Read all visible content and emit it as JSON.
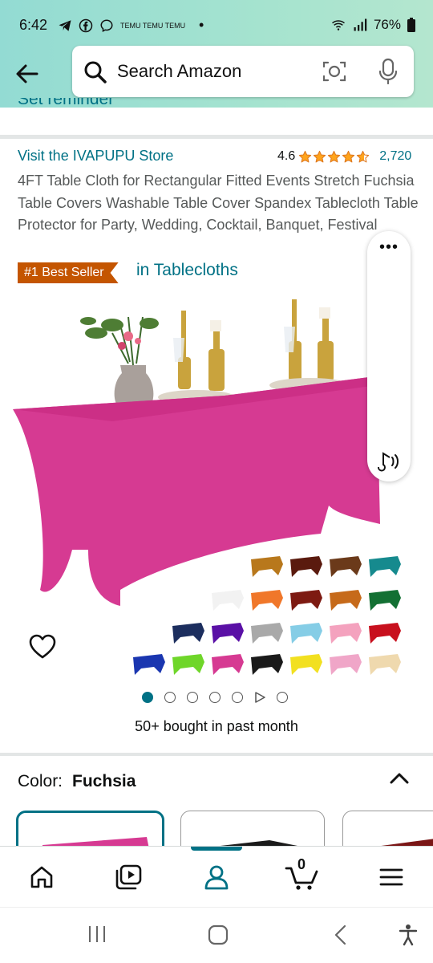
{
  "status_bar": {
    "time": "6:42",
    "notif_text": "TEMU TEMU TEMU",
    "battery": "76%"
  },
  "search": {
    "placeholder": "Search Amazon"
  },
  "reminder": {
    "label": "Set reminder"
  },
  "product": {
    "store_link": "Visit the IVAPUPU Store",
    "rating_value": "4.6",
    "rating_count": "2,720",
    "stars": 4.6,
    "title": "4FT Table Cloth for Rectangular Fitted Events Stretch Fuchsia Table Covers Washable Table Cover Spandex Tablecloth Table Protector for Party, Wedding, Cocktail, Banquet, Festival",
    "badge": "#1 Best Seller",
    "badge_category": "in Tablecloths",
    "bought": "50+ bought in past month"
  },
  "colors": {
    "accent": "#007185",
    "badge": "#c45500",
    "star": "#ffa41c",
    "product": "#d63a92"
  },
  "color_selector": {
    "label": "Color:",
    "selected": "Fuchsia",
    "swatches": [
      "#d63a92",
      "#1a1a1a",
      "#7a1616"
    ]
  },
  "image_palette": [
    "#b8781c",
    "#5a1a0e",
    "#6b3a1a",
    "#168a8e",
    "#f2f2f2",
    "#f0772a",
    "#7d1a12",
    "#c66a1a",
    "#137033",
    "#1c2e5e",
    "#5a10a6",
    "#a9a9a9",
    "#85cde6",
    "#f4a2be",
    "#c8101e",
    "#1a36b0",
    "#6fd62a",
    "#d63a92",
    "#1a1a1a",
    "#f2e020",
    "#f0a6c8",
    "#efd9ae"
  ],
  "carousel": {
    "total": 7,
    "active": 0,
    "video_index": 5
  },
  "bottom_nav": {
    "cart_count": "0",
    "items": [
      "home-icon",
      "video-icon",
      "account-icon",
      "cart-icon",
      "menu-icon"
    ]
  }
}
